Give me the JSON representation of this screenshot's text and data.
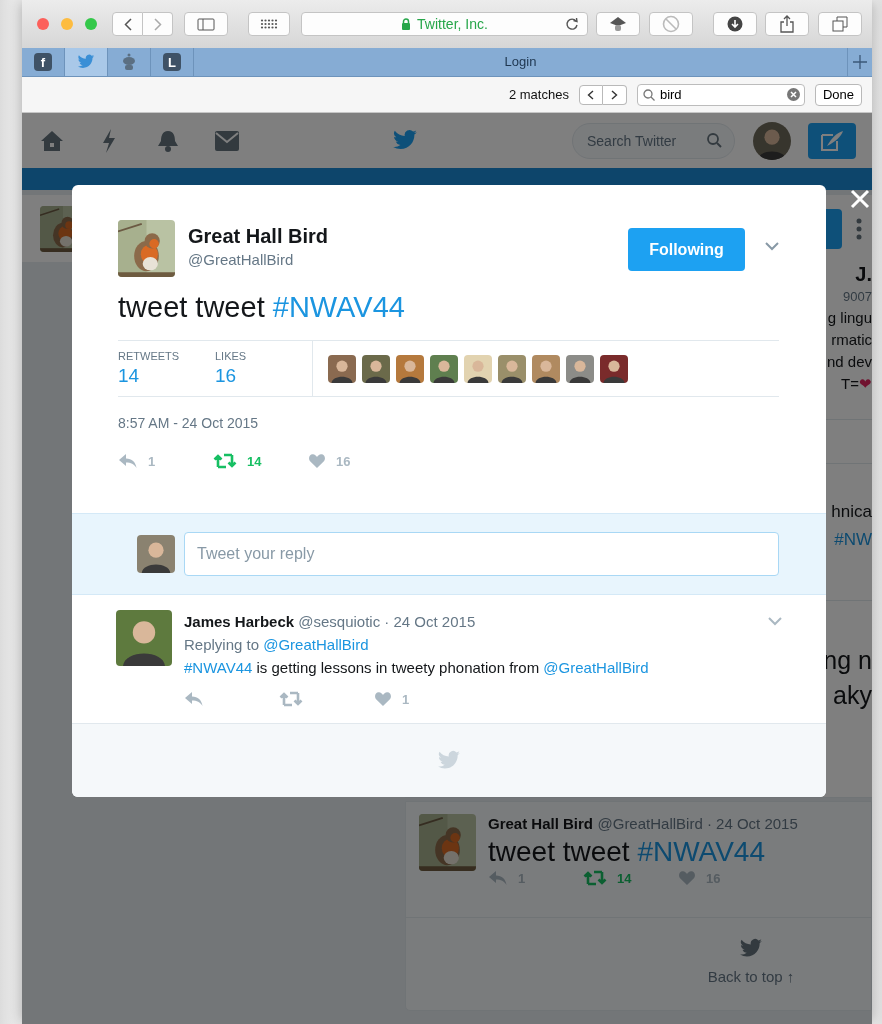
{
  "browser": {
    "address": "Twitter, Inc.",
    "tabs": [
      {
        "kind": "facebook",
        "label": "f",
        "selected": false
      },
      {
        "kind": "twitter",
        "selected": true
      },
      {
        "kind": "robot",
        "selected": false
      },
      {
        "kind": "letter",
        "label": "L",
        "selected": false
      }
    ],
    "page_title": "Login",
    "find": {
      "matches": "2 matches",
      "query": "bird",
      "done": "Done"
    }
  },
  "nav": {
    "search_placeholder": "Search Twitter"
  },
  "background": {
    "profile_lines": [
      {
        "kind": "name",
        "parts": [
          {
            "kind": "plain",
            "text": "J."
          }
        ]
      },
      {
        "kind": "meta",
        "parts": [
          {
            "kind": "plain",
            "text": "9007"
          }
        ]
      },
      {
        "kind": "bio",
        "parts": [
          {
            "kind": "plain",
            "text": "g lingu"
          }
        ]
      },
      {
        "kind": "bio",
        "parts": [
          {
            "kind": "plain",
            "text": "rmatic"
          }
        ]
      },
      {
        "kind": "bio",
        "parts": [
          {
            "kind": "plain",
            "text": "nd dev"
          }
        ]
      },
      {
        "kind": "bio",
        "parts": [
          {
            "kind": "plain",
            "text": "T="
          },
          {
            "kind": "heart",
            "text": "❤"
          }
        ]
      }
    ],
    "tweet_lines": [
      {
        "kind": "tweet",
        "parts": [
          {
            "kind": "plain",
            "text": "hnica"
          }
        ]
      },
      {
        "kind": "tweet",
        "parts": [
          {
            "kind": "hashtag",
            "text": "#NW"
          }
        ]
      }
    ],
    "large_lines": [
      {
        "kind": "large",
        "parts": [
          {
            "kind": "plain",
            "text": "ng n"
          }
        ]
      },
      {
        "kind": "large",
        "parts": [
          {
            "kind": "plain",
            "text": "aky"
          }
        ]
      }
    ],
    "tweet": {
      "name": "Great Hall Bird",
      "meta": "@GreatHallBird · 24 Oct 2015",
      "text": [
        {
          "kind": "plain",
          "text": "tweet tweet "
        },
        {
          "kind": "hashtag",
          "text": "#NWAV44"
        }
      ],
      "actions": [
        {
          "kind": "reply",
          "count": "1",
          "active": false
        },
        {
          "kind": "retweet",
          "count": "14",
          "active": true
        },
        {
          "kind": "like",
          "count": "16",
          "active": false
        }
      ]
    },
    "back_to_top": "Back to top ↑"
  },
  "modal": {
    "name": "Great Hall Bird",
    "handle": "@GreatHallBird",
    "follow_button": "Following",
    "text": [
      {
        "kind": "plain",
        "text": "tweet tweet "
      },
      {
        "kind": "hashtag",
        "text": "#NWAV44"
      }
    ],
    "stats": [
      {
        "label": "RETWEETS",
        "value": "14"
      },
      {
        "label": "LIKES",
        "value": "16"
      }
    ],
    "likers": [
      {
        "color": "#8a6a50"
      },
      {
        "color": "#6b6a4a"
      },
      {
        "color": "#b5793d"
      },
      {
        "color": "#5f7f4f"
      },
      {
        "color": "#e2d3b0"
      },
      {
        "color": "#9a8f6a"
      },
      {
        "color": "#b08a60"
      },
      {
        "color": "#8c8c88"
      },
      {
        "color": "#7a2b2b"
      }
    ],
    "timestamp": "8:57 AM - 24 Oct 2015",
    "actions": [
      {
        "kind": "reply",
        "count": "1",
        "active": false
      },
      {
        "kind": "retweet",
        "count": "14",
        "active": true
      },
      {
        "kind": "like",
        "count": "16",
        "active": false
      }
    ],
    "reply_placeholder": "Tweet your reply",
    "replies": [
      {
        "name": "James Harbeck",
        "meta": "@sesquiotic · 24 Oct 2015",
        "replying_label": "Replying to",
        "replying_to": "@GreatHallBird",
        "text": [
          {
            "kind": "hashtag",
            "text": "#NWAV44"
          },
          {
            "kind": "plain",
            "text": " is getting lessons in tweety phonation from "
          },
          {
            "kind": "mention",
            "text": "@GreatHallBird"
          }
        ],
        "actions": [
          {
            "kind": "reply",
            "active": false
          },
          {
            "kind": "retweet",
            "active": false
          },
          {
            "kind": "like",
            "count": "1",
            "active": false
          }
        ]
      }
    ]
  }
}
